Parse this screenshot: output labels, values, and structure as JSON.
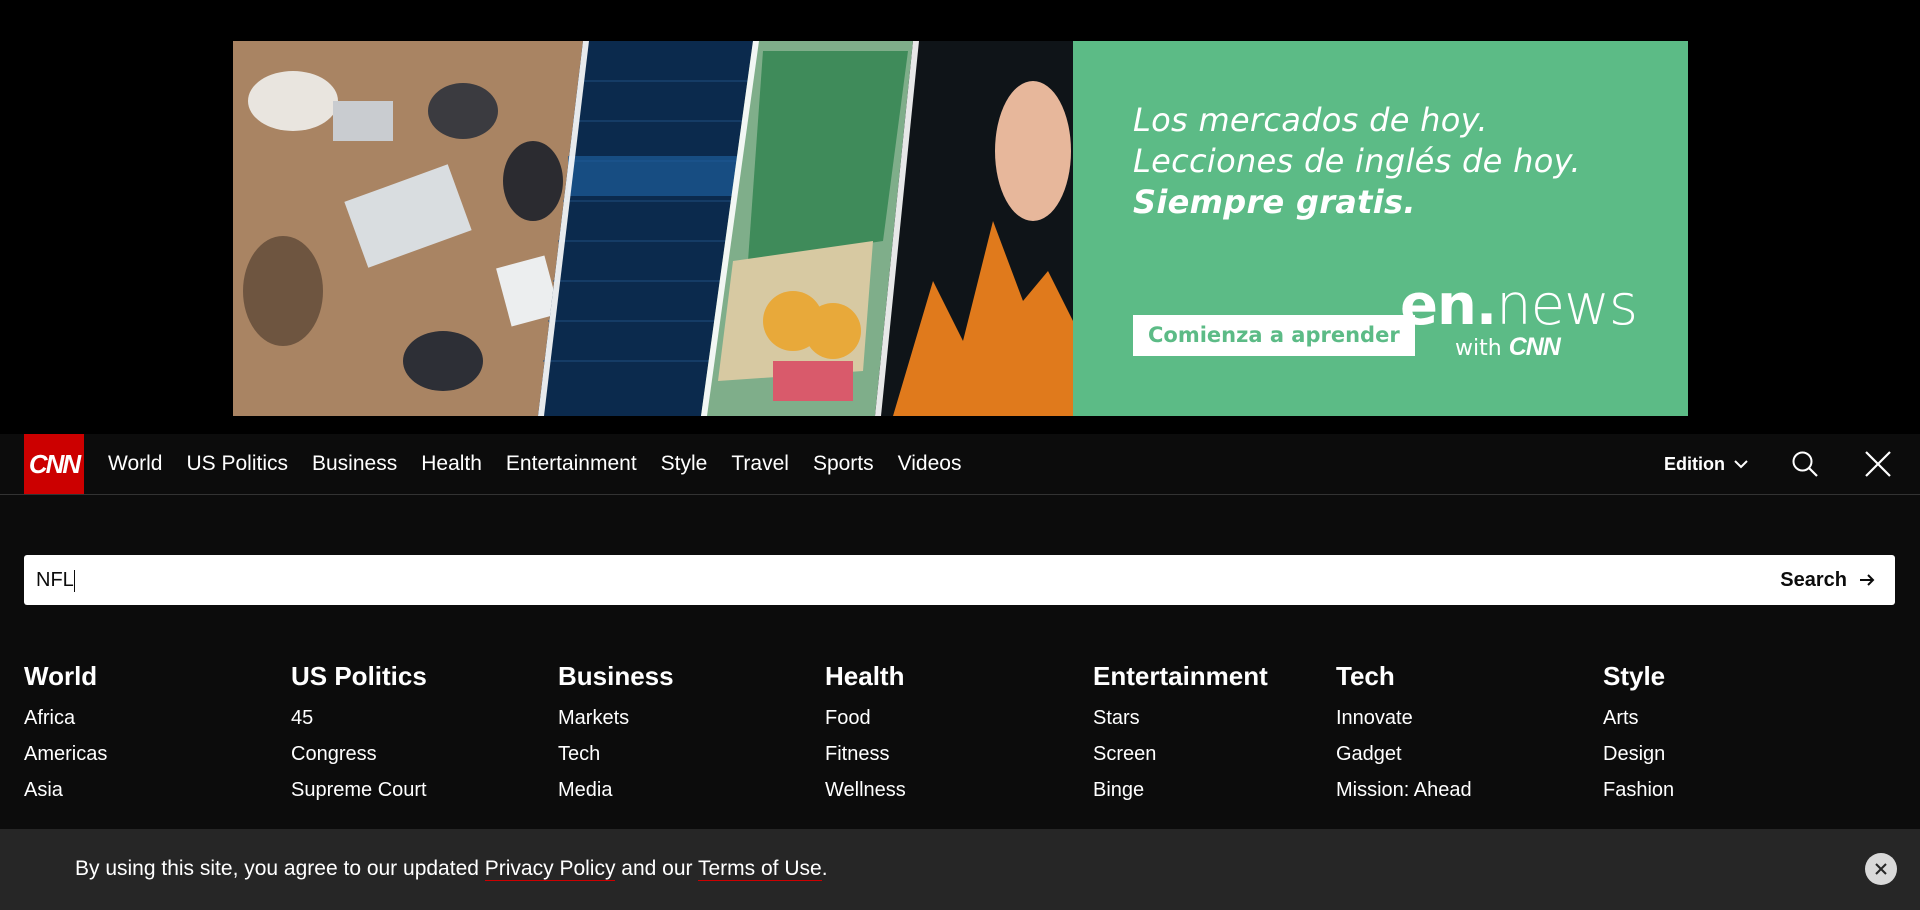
{
  "ad": {
    "line1": "Los mercados de hoy.",
    "line2": "Lecciones de inglés de hoy.",
    "line3": "Siempre gratis.",
    "cta_label": "Comienza a aprender",
    "logo_bold": "en.",
    "logo_light": "news",
    "with_label": "with",
    "with_brand": "CNN",
    "green_color": "#5cbb86"
  },
  "header": {
    "logo_text": "CNN",
    "brand_color": "#cc0000",
    "nav": [
      {
        "label": "World"
      },
      {
        "label": "US Politics"
      },
      {
        "label": "Business"
      },
      {
        "label": "Health"
      },
      {
        "label": "Entertainment"
      },
      {
        "label": "Style"
      },
      {
        "label": "Travel"
      },
      {
        "label": "Sports"
      },
      {
        "label": "Videos"
      }
    ],
    "edition_label": "Edition",
    "search_icon": "search-icon",
    "close_icon": "close-icon"
  },
  "search": {
    "value": "NFL",
    "button_label": "Search"
  },
  "sections": [
    {
      "title": "World",
      "items": [
        "Africa",
        "Americas",
        "Asia"
      ]
    },
    {
      "title": "US Politics",
      "items": [
        "45",
        "Congress",
        "Supreme Court"
      ]
    },
    {
      "title": "Business",
      "items": [
        "Markets",
        "Tech",
        "Media"
      ]
    },
    {
      "title": "Health",
      "items": [
        "Food",
        "Fitness",
        "Wellness"
      ]
    },
    {
      "title": "Entertainment",
      "items": [
        "Stars",
        "Screen",
        "Binge"
      ]
    },
    {
      "title": "Tech",
      "items": [
        "Innovate",
        "Gadget",
        "Mission: Ahead"
      ]
    },
    {
      "title": "Style",
      "items": [
        "Arts",
        "Design",
        "Fashion"
      ]
    }
  ],
  "cookie": {
    "text_before": "By using this site, you agree to our updated ",
    "privacy_label": "Privacy Policy",
    "text_middle": " and our ",
    "terms_label": "Terms of Use",
    "text_after": "."
  }
}
